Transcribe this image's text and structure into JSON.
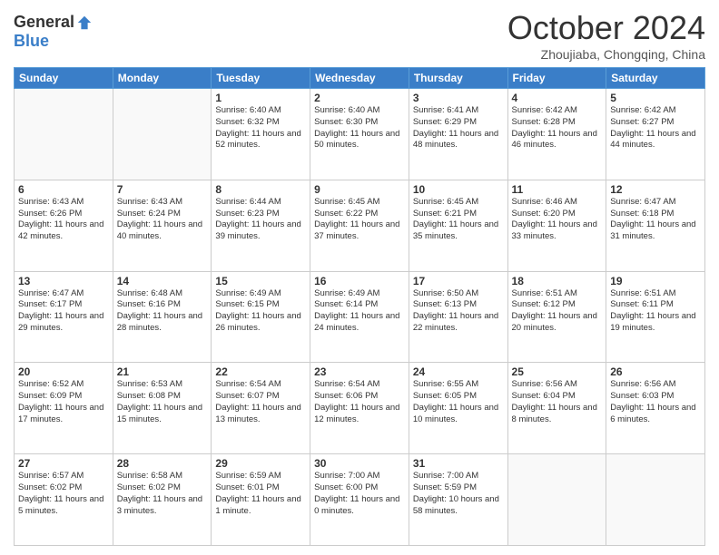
{
  "logo": {
    "general": "General",
    "blue": "Blue"
  },
  "header": {
    "month": "October 2024",
    "location": "Zhoujiaba, Chongqing, China"
  },
  "weekdays": [
    "Sunday",
    "Monday",
    "Tuesday",
    "Wednesday",
    "Thursday",
    "Friday",
    "Saturday"
  ],
  "weeks": [
    [
      {
        "day": "",
        "detail": ""
      },
      {
        "day": "",
        "detail": ""
      },
      {
        "day": "1",
        "detail": "Sunrise: 6:40 AM\nSunset: 6:32 PM\nDaylight: 11 hours and 52 minutes."
      },
      {
        "day": "2",
        "detail": "Sunrise: 6:40 AM\nSunset: 6:30 PM\nDaylight: 11 hours and 50 minutes."
      },
      {
        "day": "3",
        "detail": "Sunrise: 6:41 AM\nSunset: 6:29 PM\nDaylight: 11 hours and 48 minutes."
      },
      {
        "day": "4",
        "detail": "Sunrise: 6:42 AM\nSunset: 6:28 PM\nDaylight: 11 hours and 46 minutes."
      },
      {
        "day": "5",
        "detail": "Sunrise: 6:42 AM\nSunset: 6:27 PM\nDaylight: 11 hours and 44 minutes."
      }
    ],
    [
      {
        "day": "6",
        "detail": "Sunrise: 6:43 AM\nSunset: 6:26 PM\nDaylight: 11 hours and 42 minutes."
      },
      {
        "day": "7",
        "detail": "Sunrise: 6:43 AM\nSunset: 6:24 PM\nDaylight: 11 hours and 40 minutes."
      },
      {
        "day": "8",
        "detail": "Sunrise: 6:44 AM\nSunset: 6:23 PM\nDaylight: 11 hours and 39 minutes."
      },
      {
        "day": "9",
        "detail": "Sunrise: 6:45 AM\nSunset: 6:22 PM\nDaylight: 11 hours and 37 minutes."
      },
      {
        "day": "10",
        "detail": "Sunrise: 6:45 AM\nSunset: 6:21 PM\nDaylight: 11 hours and 35 minutes."
      },
      {
        "day": "11",
        "detail": "Sunrise: 6:46 AM\nSunset: 6:20 PM\nDaylight: 11 hours and 33 minutes."
      },
      {
        "day": "12",
        "detail": "Sunrise: 6:47 AM\nSunset: 6:18 PM\nDaylight: 11 hours and 31 minutes."
      }
    ],
    [
      {
        "day": "13",
        "detail": "Sunrise: 6:47 AM\nSunset: 6:17 PM\nDaylight: 11 hours and 29 minutes."
      },
      {
        "day": "14",
        "detail": "Sunrise: 6:48 AM\nSunset: 6:16 PM\nDaylight: 11 hours and 28 minutes."
      },
      {
        "day": "15",
        "detail": "Sunrise: 6:49 AM\nSunset: 6:15 PM\nDaylight: 11 hours and 26 minutes."
      },
      {
        "day": "16",
        "detail": "Sunrise: 6:49 AM\nSunset: 6:14 PM\nDaylight: 11 hours and 24 minutes."
      },
      {
        "day": "17",
        "detail": "Sunrise: 6:50 AM\nSunset: 6:13 PM\nDaylight: 11 hours and 22 minutes."
      },
      {
        "day": "18",
        "detail": "Sunrise: 6:51 AM\nSunset: 6:12 PM\nDaylight: 11 hours and 20 minutes."
      },
      {
        "day": "19",
        "detail": "Sunrise: 6:51 AM\nSunset: 6:11 PM\nDaylight: 11 hours and 19 minutes."
      }
    ],
    [
      {
        "day": "20",
        "detail": "Sunrise: 6:52 AM\nSunset: 6:09 PM\nDaylight: 11 hours and 17 minutes."
      },
      {
        "day": "21",
        "detail": "Sunrise: 6:53 AM\nSunset: 6:08 PM\nDaylight: 11 hours and 15 minutes."
      },
      {
        "day": "22",
        "detail": "Sunrise: 6:54 AM\nSunset: 6:07 PM\nDaylight: 11 hours and 13 minutes."
      },
      {
        "day": "23",
        "detail": "Sunrise: 6:54 AM\nSunset: 6:06 PM\nDaylight: 11 hours and 12 minutes."
      },
      {
        "day": "24",
        "detail": "Sunrise: 6:55 AM\nSunset: 6:05 PM\nDaylight: 11 hours and 10 minutes."
      },
      {
        "day": "25",
        "detail": "Sunrise: 6:56 AM\nSunset: 6:04 PM\nDaylight: 11 hours and 8 minutes."
      },
      {
        "day": "26",
        "detail": "Sunrise: 6:56 AM\nSunset: 6:03 PM\nDaylight: 11 hours and 6 minutes."
      }
    ],
    [
      {
        "day": "27",
        "detail": "Sunrise: 6:57 AM\nSunset: 6:02 PM\nDaylight: 11 hours and 5 minutes."
      },
      {
        "day": "28",
        "detail": "Sunrise: 6:58 AM\nSunset: 6:02 PM\nDaylight: 11 hours and 3 minutes."
      },
      {
        "day": "29",
        "detail": "Sunrise: 6:59 AM\nSunset: 6:01 PM\nDaylight: 11 hours and 1 minute."
      },
      {
        "day": "30",
        "detail": "Sunrise: 7:00 AM\nSunset: 6:00 PM\nDaylight: 11 hours and 0 minutes."
      },
      {
        "day": "31",
        "detail": "Sunrise: 7:00 AM\nSunset: 5:59 PM\nDaylight: 10 hours and 58 minutes."
      },
      {
        "day": "",
        "detail": ""
      },
      {
        "day": "",
        "detail": ""
      }
    ]
  ]
}
